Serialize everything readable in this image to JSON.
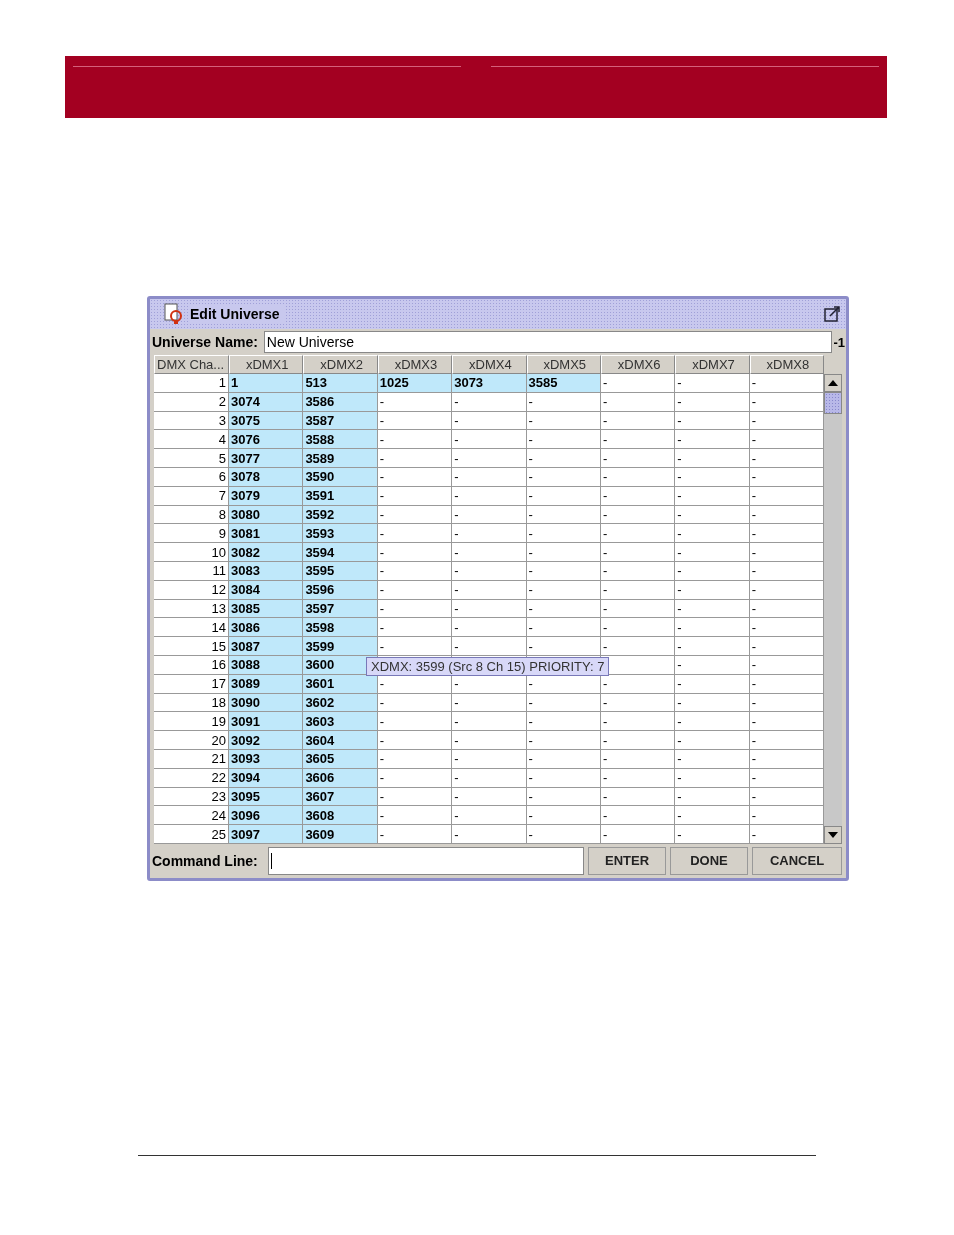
{
  "dialog": {
    "title": "Edit Universe",
    "name_label": "Universe Name:",
    "name_value": "New Universe",
    "name_suffix": "-1"
  },
  "table": {
    "columns": [
      "DMX Cha...",
      "xDMX1",
      "xDMX2",
      "xDMX3",
      "xDMX4",
      "xDMX5",
      "xDMX6",
      "xDMX7",
      "xDMX8"
    ],
    "rows": [
      {
        "channel": "1",
        "cells": [
          {
            "text": "1",
            "highlighted": true
          },
          {
            "text": "513",
            "highlighted": true
          },
          {
            "text": "1025",
            "highlighted": true
          },
          {
            "text": "3073",
            "highlighted": true
          },
          {
            "text": "3585",
            "highlighted": true
          },
          {
            "text": "-",
            "highlighted": false
          },
          {
            "text": "-",
            "highlighted": false
          },
          {
            "text": "-",
            "highlighted": false
          }
        ]
      },
      {
        "channel": "2",
        "cells": [
          {
            "text": "3074",
            "highlighted": true
          },
          {
            "text": "3586",
            "highlighted": true
          },
          {
            "text": "-",
            "highlighted": false
          },
          {
            "text": "-",
            "highlighted": false
          },
          {
            "text": "-",
            "highlighted": false
          },
          {
            "text": "-",
            "highlighted": false
          },
          {
            "text": "-",
            "highlighted": false
          },
          {
            "text": "-",
            "highlighted": false
          }
        ]
      },
      {
        "channel": "3",
        "cells": [
          {
            "text": "3075",
            "highlighted": true
          },
          {
            "text": "3587",
            "highlighted": true
          },
          {
            "text": "-",
            "highlighted": false
          },
          {
            "text": "-",
            "highlighted": false
          },
          {
            "text": "-",
            "highlighted": false
          },
          {
            "text": "-",
            "highlighted": false
          },
          {
            "text": "-",
            "highlighted": false
          },
          {
            "text": "-",
            "highlighted": false
          }
        ]
      },
      {
        "channel": "4",
        "cells": [
          {
            "text": "3076",
            "highlighted": true
          },
          {
            "text": "3588",
            "highlighted": true
          },
          {
            "text": "-",
            "highlighted": false
          },
          {
            "text": "-",
            "highlighted": false
          },
          {
            "text": "-",
            "highlighted": false
          },
          {
            "text": "-",
            "highlighted": false
          },
          {
            "text": "-",
            "highlighted": false
          },
          {
            "text": "-",
            "highlighted": false
          }
        ]
      },
      {
        "channel": "5",
        "cells": [
          {
            "text": "3077",
            "highlighted": true
          },
          {
            "text": "3589",
            "highlighted": true
          },
          {
            "text": "-",
            "highlighted": false
          },
          {
            "text": "-",
            "highlighted": false
          },
          {
            "text": "-",
            "highlighted": false
          },
          {
            "text": "-",
            "highlighted": false
          },
          {
            "text": "-",
            "highlighted": false
          },
          {
            "text": "-",
            "highlighted": false
          }
        ]
      },
      {
        "channel": "6",
        "cells": [
          {
            "text": "3078",
            "highlighted": true
          },
          {
            "text": "3590",
            "highlighted": true
          },
          {
            "text": "-",
            "highlighted": false
          },
          {
            "text": "-",
            "highlighted": false
          },
          {
            "text": "-",
            "highlighted": false
          },
          {
            "text": "-",
            "highlighted": false
          },
          {
            "text": "-",
            "highlighted": false
          },
          {
            "text": "-",
            "highlighted": false
          }
        ]
      },
      {
        "channel": "7",
        "cells": [
          {
            "text": "3079",
            "highlighted": true
          },
          {
            "text": "3591",
            "highlighted": true
          },
          {
            "text": "-",
            "highlighted": false
          },
          {
            "text": "-",
            "highlighted": false
          },
          {
            "text": "-",
            "highlighted": false
          },
          {
            "text": "-",
            "highlighted": false
          },
          {
            "text": "-",
            "highlighted": false
          },
          {
            "text": "-",
            "highlighted": false
          }
        ]
      },
      {
        "channel": "8",
        "cells": [
          {
            "text": "3080",
            "highlighted": true
          },
          {
            "text": "3592",
            "highlighted": true
          },
          {
            "text": "-",
            "highlighted": false
          },
          {
            "text": "-",
            "highlighted": false
          },
          {
            "text": "-",
            "highlighted": false
          },
          {
            "text": "-",
            "highlighted": false
          },
          {
            "text": "-",
            "highlighted": false
          },
          {
            "text": "-",
            "highlighted": false
          }
        ]
      },
      {
        "channel": "9",
        "cells": [
          {
            "text": "3081",
            "highlighted": true
          },
          {
            "text": "3593",
            "highlighted": true
          },
          {
            "text": "-",
            "highlighted": false
          },
          {
            "text": "-",
            "highlighted": false
          },
          {
            "text": "-",
            "highlighted": false
          },
          {
            "text": "-",
            "highlighted": false
          },
          {
            "text": "-",
            "highlighted": false
          },
          {
            "text": "-",
            "highlighted": false
          }
        ]
      },
      {
        "channel": "10",
        "cells": [
          {
            "text": "3082",
            "highlighted": true
          },
          {
            "text": "3594",
            "highlighted": true
          },
          {
            "text": "-",
            "highlighted": false
          },
          {
            "text": "-",
            "highlighted": false
          },
          {
            "text": "-",
            "highlighted": false
          },
          {
            "text": "-",
            "highlighted": false
          },
          {
            "text": "-",
            "highlighted": false
          },
          {
            "text": "-",
            "highlighted": false
          }
        ]
      },
      {
        "channel": "11",
        "cells": [
          {
            "text": "3083",
            "highlighted": true
          },
          {
            "text": "3595",
            "highlighted": true
          },
          {
            "text": "-",
            "highlighted": false
          },
          {
            "text": "-",
            "highlighted": false
          },
          {
            "text": "-",
            "highlighted": false
          },
          {
            "text": "-",
            "highlighted": false
          },
          {
            "text": "-",
            "highlighted": false
          },
          {
            "text": "-",
            "highlighted": false
          }
        ]
      },
      {
        "channel": "12",
        "cells": [
          {
            "text": "3084",
            "highlighted": true
          },
          {
            "text": "3596",
            "highlighted": true
          },
          {
            "text": "-",
            "highlighted": false
          },
          {
            "text": "-",
            "highlighted": false
          },
          {
            "text": "-",
            "highlighted": false
          },
          {
            "text": "-",
            "highlighted": false
          },
          {
            "text": "-",
            "highlighted": false
          },
          {
            "text": "-",
            "highlighted": false
          }
        ]
      },
      {
        "channel": "13",
        "cells": [
          {
            "text": "3085",
            "highlighted": true
          },
          {
            "text": "3597",
            "highlighted": true
          },
          {
            "text": "-",
            "highlighted": false
          },
          {
            "text": "-",
            "highlighted": false
          },
          {
            "text": "-",
            "highlighted": false
          },
          {
            "text": "-",
            "highlighted": false
          },
          {
            "text": "-",
            "highlighted": false
          },
          {
            "text": "-",
            "highlighted": false
          }
        ]
      },
      {
        "channel": "14",
        "cells": [
          {
            "text": "3086",
            "highlighted": true
          },
          {
            "text": "3598",
            "highlighted": true
          },
          {
            "text": "-",
            "highlighted": false
          },
          {
            "text": "-",
            "highlighted": false
          },
          {
            "text": "-",
            "highlighted": false
          },
          {
            "text": "-",
            "highlighted": false
          },
          {
            "text": "-",
            "highlighted": false
          },
          {
            "text": "-",
            "highlighted": false
          }
        ]
      },
      {
        "channel": "15",
        "cells": [
          {
            "text": "3087",
            "highlighted": true
          },
          {
            "text": "3599",
            "highlighted": true
          },
          {
            "text": "-",
            "highlighted": false
          },
          {
            "text": "-",
            "highlighted": false
          },
          {
            "text": "-",
            "highlighted": false
          },
          {
            "text": "-",
            "highlighted": false
          },
          {
            "text": "-",
            "highlighted": false
          },
          {
            "text": "-",
            "highlighted": false
          }
        ]
      },
      {
        "channel": "16",
        "cells": [
          {
            "text": "3088",
            "highlighted": true
          },
          {
            "text": "3600",
            "highlighted": true
          },
          {
            "highlighted": false
          },
          {
            "highlighted": false
          },
          {
            "highlighted": false
          },
          {
            "highlighted": false
          },
          {
            "text": "-",
            "highlighted": false
          },
          {
            "text": "-",
            "highlighted": false
          }
        ]
      },
      {
        "channel": "17",
        "cells": [
          {
            "text": "3089",
            "highlighted": true
          },
          {
            "text": "3601",
            "highlighted": true
          },
          {
            "text": "-",
            "highlighted": false
          },
          {
            "text": "-",
            "highlighted": false
          },
          {
            "text": "-",
            "highlighted": false
          },
          {
            "text": "-",
            "highlighted": false
          },
          {
            "text": "-",
            "highlighted": false
          },
          {
            "text": "-",
            "highlighted": false
          }
        ]
      },
      {
        "channel": "18",
        "cells": [
          {
            "text": "3090",
            "highlighted": true
          },
          {
            "text": "3602",
            "highlighted": true
          },
          {
            "text": "-",
            "highlighted": false
          },
          {
            "text": "-",
            "highlighted": false
          },
          {
            "text": "-",
            "highlighted": false
          },
          {
            "text": "-",
            "highlighted": false
          },
          {
            "text": "-",
            "highlighted": false
          },
          {
            "text": "-",
            "highlighted": false
          }
        ]
      },
      {
        "channel": "19",
        "cells": [
          {
            "text": "3091",
            "highlighted": true
          },
          {
            "text": "3603",
            "highlighted": true
          },
          {
            "text": "-",
            "highlighted": false
          },
          {
            "text": "-",
            "highlighted": false
          },
          {
            "text": "-",
            "highlighted": false
          },
          {
            "text": "-",
            "highlighted": false
          },
          {
            "text": "-",
            "highlighted": false
          },
          {
            "text": "-",
            "highlighted": false
          }
        ]
      },
      {
        "channel": "20",
        "cells": [
          {
            "text": "3092",
            "highlighted": true
          },
          {
            "text": "3604",
            "highlighted": true
          },
          {
            "text": "-",
            "highlighted": false
          },
          {
            "text": "-",
            "highlighted": false
          },
          {
            "text": "-",
            "highlighted": false
          },
          {
            "text": "-",
            "highlighted": false
          },
          {
            "text": "-",
            "highlighted": false
          },
          {
            "text": "-",
            "highlighted": false
          }
        ]
      },
      {
        "channel": "21",
        "cells": [
          {
            "text": "3093",
            "highlighted": true
          },
          {
            "text": "3605",
            "highlighted": true
          },
          {
            "text": "-",
            "highlighted": false
          },
          {
            "text": "-",
            "highlighted": false
          },
          {
            "text": "-",
            "highlighted": false
          },
          {
            "text": "-",
            "highlighted": false
          },
          {
            "text": "-",
            "highlighted": false
          },
          {
            "text": "-",
            "highlighted": false
          }
        ]
      },
      {
        "channel": "22",
        "cells": [
          {
            "text": "3094",
            "highlighted": true
          },
          {
            "text": "3606",
            "highlighted": true
          },
          {
            "text": "-",
            "highlighted": false
          },
          {
            "text": "-",
            "highlighted": false
          },
          {
            "text": "-",
            "highlighted": false
          },
          {
            "text": "-",
            "highlighted": false
          },
          {
            "text": "-",
            "highlighted": false
          },
          {
            "text": "-",
            "highlighted": false
          }
        ]
      },
      {
        "channel": "23",
        "cells": [
          {
            "text": "3095",
            "highlighted": true
          },
          {
            "text": "3607",
            "highlighted": true
          },
          {
            "text": "-",
            "highlighted": false
          },
          {
            "text": "-",
            "highlighted": false
          },
          {
            "text": "-",
            "highlighted": false
          },
          {
            "text": "-",
            "highlighted": false
          },
          {
            "text": "-",
            "highlighted": false
          },
          {
            "text": "-",
            "highlighted": false
          }
        ]
      },
      {
        "channel": "24",
        "cells": [
          {
            "text": "3096",
            "highlighted": true
          },
          {
            "text": "3608",
            "highlighted": true
          },
          {
            "text": "-",
            "highlighted": false
          },
          {
            "text": "-",
            "highlighted": false
          },
          {
            "text": "-",
            "highlighted": false
          },
          {
            "text": "-",
            "highlighted": false
          },
          {
            "text": "-",
            "highlighted": false
          },
          {
            "text": "-",
            "highlighted": false
          }
        ]
      },
      {
        "channel": "25",
        "cells": [
          {
            "text": "3097",
            "highlighted": true
          },
          {
            "text": "3609",
            "highlighted": true
          },
          {
            "text": "-",
            "highlighted": false
          },
          {
            "text": "-",
            "highlighted": false
          },
          {
            "text": "-",
            "highlighted": false
          },
          {
            "text": "-",
            "highlighted": false
          },
          {
            "text": "-",
            "highlighted": false
          },
          {
            "text": "-",
            "highlighted": false
          }
        ]
      }
    ]
  },
  "tooltip": "XDMX: 3599 (Src 8 Ch 15) PRIORITY: 7",
  "command": {
    "label": "Command Line:",
    "buttons": [
      "ENTER",
      "DONE",
      "CANCEL"
    ]
  }
}
